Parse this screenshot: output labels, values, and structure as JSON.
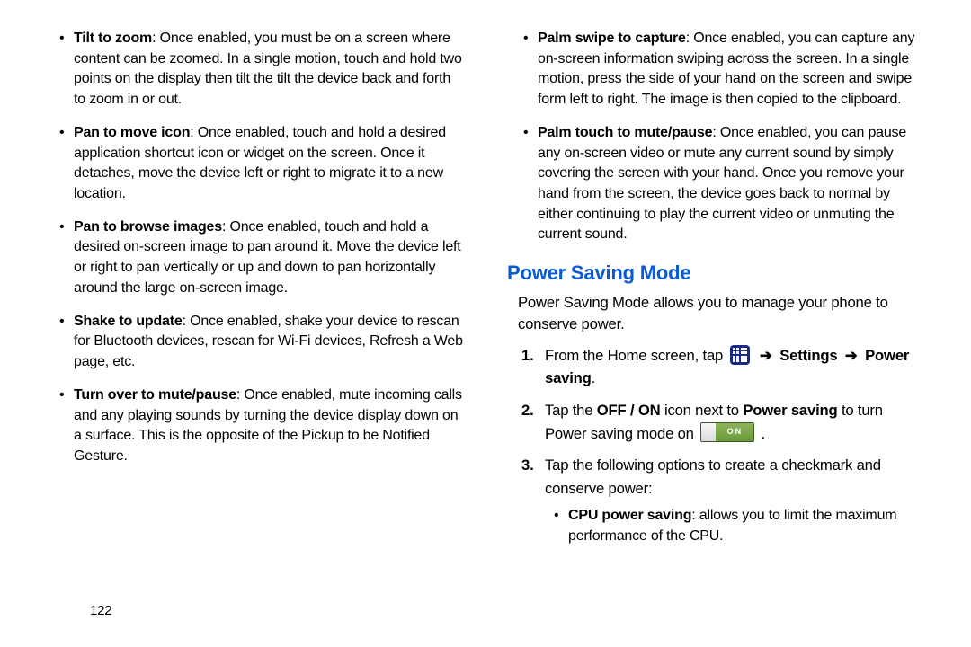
{
  "page_number": "122",
  "left": {
    "bullets": [
      {
        "term": "Tilt to zoom",
        "desc": ": Once enabled, you must be on a screen where content can be zoomed. In a single motion, touch and hold two points on the display then tilt the tilt the device back and forth to zoom in or out."
      },
      {
        "term": "Pan to move icon",
        "desc": ": Once enabled, touch and hold a desired application shortcut icon or widget on the screen. Once it detaches, move the device left or right to migrate it to a new location."
      },
      {
        "term": "Pan to browse images",
        "desc": ": Once enabled, touch and hold a desired on-screen image to pan around it. Move the device left or right to pan vertically or up and down to pan horizontally around the large on-screen image."
      },
      {
        "term": "Shake to update",
        "desc": ": Once enabled, shake your device to rescan for Bluetooth devices, rescan for Wi-Fi devices, Refresh a Web page, etc."
      },
      {
        "term": "Turn over to mute/pause",
        "desc": ": Once enabled, mute incoming calls and any playing sounds by turning the device display down on a surface. This is the opposite of the Pickup to be Notified Gesture."
      }
    ]
  },
  "right": {
    "bullets": [
      {
        "term": "Palm swipe to capture",
        "desc": ": Once enabled, you can capture any on-screen information swiping across the screen. In a single motion, press the side of your hand on the screen and swipe form left to right. The image is then copied to the clipboard."
      },
      {
        "term": "Palm touch to mute/pause",
        "desc": ": Once enabled, you can pause any on-screen video or mute any current sound by simply covering the screen with your hand. Once you remove your hand from the screen, the device goes back to normal by either continuing to play the current video or unmuting the current sound."
      }
    ],
    "heading": "Power Saving Mode",
    "intro": "Power Saving Mode allows you to manage your phone to conserve power.",
    "steps": {
      "s1_pre": "From the Home screen, tap ",
      "s1_arrow": "➔",
      "s1_settings": "Settings",
      "s1_ps": "Power saving",
      "s1_period": ".",
      "s2_pre": "Tap the ",
      "s2_offon": "OFF / ON",
      "s2_mid": " icon next to ",
      "s2_ps": "Power saving",
      "s2_mid2": " to turn Power saving mode on ",
      "toggle_label": "ON",
      "s2_period": ".",
      "s3": "Tap the following options to create a checkmark and conserve power:",
      "sub_term": "CPU power saving",
      "sub_desc": ": allows you to limit the maximum performance of the CPU."
    }
  }
}
